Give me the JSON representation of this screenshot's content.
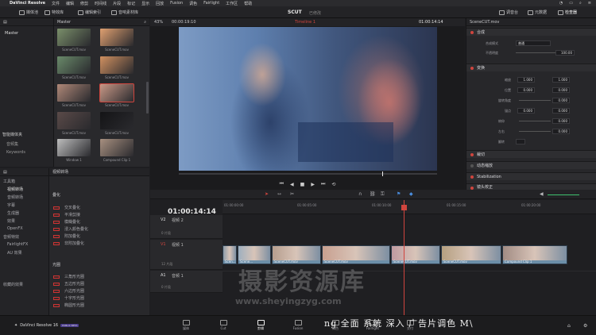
{
  "menubar": {
    "app_name": "DaVinci Resolve",
    "menus": [
      "文件",
      "编辑",
      "修剪",
      "时间线",
      "片段",
      "标记",
      "显示",
      "回放",
      "Fusion",
      "调色",
      "Fairlight",
      "工作区",
      "帮助"
    ]
  },
  "toolbar": {
    "media_pool": "媒体池",
    "effects_library": "特效库",
    "edit_index": "编辑索引",
    "sound_library": "音响素材库",
    "project_title": "SCUT",
    "project_status": "已修改",
    "mixer": "调音台",
    "metadata": "元数据",
    "inspector": "检查器"
  },
  "media_pool": {
    "bin_master": "Master",
    "header_label": "Master",
    "smart_bins_title": "智能媒体夹",
    "smart_bins": [
      "音频集",
      "Keywords"
    ],
    "clips": [
      {
        "name": "SceneCUT.mov",
        "color": "#7a8f6a"
      },
      {
        "name": "SceneCUT.mov",
        "color": "#e0a070"
      },
      {
        "name": "SceneCUT.mov",
        "color": "#6a8a6a"
      },
      {
        "name": "SceneCUT.mov",
        "color": "#d09060"
      },
      {
        "name": "SceneCUT.mov",
        "color": "#b08878"
      },
      {
        "name": "SceneCUT.mov",
        "color": "#c89886"
      },
      {
        "name": "SceneCUT.mov",
        "color": "#5a4a48"
      },
      {
        "name": "SceneCUT.mov",
        "color": "#141416"
      },
      {
        "name": "Window 1",
        "color": "#bdbdbd"
      },
      {
        "name": "Compound Clip 1",
        "color": "#a89080"
      }
    ]
  },
  "effects": {
    "categories": [
      "工具箱",
      "视频转场",
      "音频转场",
      "字幕",
      "生成器",
      "效果",
      "OpenFX",
      "音频特效",
      "FairlightFX",
      "AU 效果"
    ],
    "favorites": "收藏的效果",
    "list_header": "视频转场",
    "section_fade": "叠化",
    "fade_items": [
      "交叉叠化",
      "平滑剪接",
      "模糊叠化",
      "浸入颜色叠化",
      "附加叠化",
      "非附加叠化"
    ],
    "section_iris": "光圈",
    "iris_items": [
      "三角形光圈",
      "五边形光圈",
      "六边形光圈",
      "十字形光圈",
      "椭圆形光圈"
    ]
  },
  "viewer": {
    "zoom": "43%",
    "source_tc": "00:00:19:10",
    "timeline_name": "Timeline 1",
    "record_tc": "01:00:14:14"
  },
  "inspector": {
    "clip_name": "SceneCUT.mov",
    "sections": {
      "composite": "合成",
      "transform": "变换",
      "crop": "裁切",
      "dynamic_zoom": "动态缩放",
      "stabilization": "Stabilization",
      "lens_correction": "镜头校正"
    },
    "composite_mode_label": "合成模式",
    "composite_mode_value": "普通",
    "opacity_label": "不透明度",
    "opacity_value": "100.00",
    "zoom_label": "缩放",
    "zoom_x": "1.000",
    "zoom_y": "1.000",
    "position_label": "位置",
    "position_x": "0.000",
    "position_y": "0.000",
    "rotation_label": "旋转角度",
    "rotation_value": "0.000",
    "anchor_label": "锚点",
    "anchor_x": "0.000",
    "anchor_y": "0.000",
    "pitch_label": "俯仰",
    "pitch_value": "0.000",
    "yaw_label": "左右",
    "yaw_value": "0.000",
    "flip_label": "翻转"
  },
  "timeline": {
    "timecode": "01:00:14:14",
    "ruler": [
      "01:00:00:00",
      "01:00:05:00",
      "01:00:10:00",
      "01:00:15:00",
      "01:00:20:00"
    ],
    "tracks": [
      {
        "id": "V2",
        "label": "视频 2",
        "count": "0 片段"
      },
      {
        "id": "V1",
        "label": "视频 1",
        "count": "12 片段"
      },
      {
        "id": "A1",
        "label": "音频 1",
        "count": "0 片段"
      }
    ],
    "clips": [
      {
        "name": "Scen...",
        "color": "#8d9ca8"
      },
      {
        "name": "Scene...",
        "color": "#9fb0bf"
      },
      {
        "name": "SceneCUT.mov",
        "color": "#b69e8e"
      },
      {
        "name": "SceneCUT.mov",
        "color": "#c8a090"
      },
      {
        "name": "SceneCUT.mov",
        "color": "#c09aa0"
      },
      {
        "name": "SceneCUT.mov",
        "color": "#b6a080"
      },
      {
        "name": "Compound Clip 1",
        "color": "#a28c84"
      }
    ]
  },
  "pages": [
    "媒体",
    "Cut",
    "剪辑",
    "Fusion",
    "调色",
    "Fairlight",
    "交付"
  ],
  "brand": {
    "name": "DaVinci Resolve 16",
    "badge": "PUBLIC BETA"
  },
  "watermark": {
    "cn": "摄影资源库",
    "url": "www.sheyingzyg.com"
  },
  "caption": "ng 全面 系统 深入 广告片调色 M\\",
  "colors": {
    "accent": "#d0453e",
    "clip": "#6c8ea8"
  }
}
